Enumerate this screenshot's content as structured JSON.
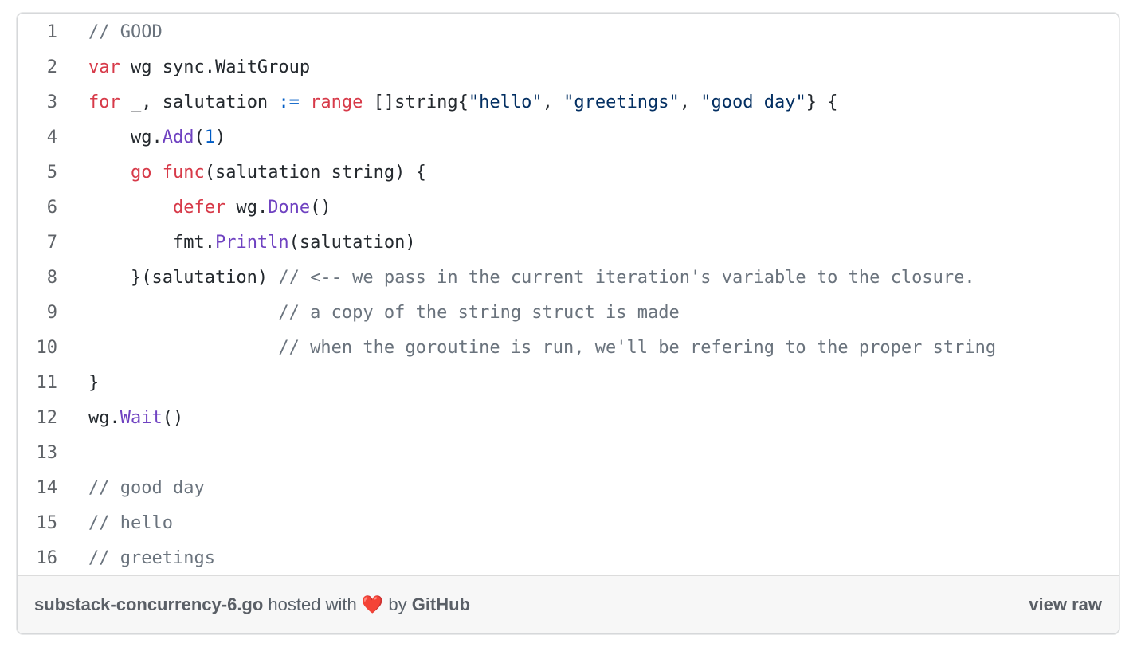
{
  "code": {
    "language": "go",
    "lines": [
      {
        "n": "1",
        "tokens": [
          {
            "t": "// GOOD",
            "c": "com"
          }
        ]
      },
      {
        "n": "2",
        "tokens": [
          {
            "t": "var",
            "c": "kw"
          },
          {
            "t": " wg sync.WaitGroup",
            "c": ""
          }
        ]
      },
      {
        "n": "3",
        "tokens": [
          {
            "t": "for",
            "c": "kw"
          },
          {
            "t": " _, salutation ",
            "c": ""
          },
          {
            "t": ":=",
            "c": "op"
          },
          {
            "t": " ",
            "c": ""
          },
          {
            "t": "range",
            "c": "kw"
          },
          {
            "t": " []string{",
            "c": ""
          },
          {
            "t": "\"hello\"",
            "c": "str"
          },
          {
            "t": ", ",
            "c": ""
          },
          {
            "t": "\"greetings\"",
            "c": "str"
          },
          {
            "t": ", ",
            "c": ""
          },
          {
            "t": "\"good day\"",
            "c": "str"
          },
          {
            "t": "} {",
            "c": ""
          }
        ]
      },
      {
        "n": "4",
        "tokens": [
          {
            "t": "    wg.",
            "c": ""
          },
          {
            "t": "Add",
            "c": "fn"
          },
          {
            "t": "(",
            "c": ""
          },
          {
            "t": "1",
            "c": "num"
          },
          {
            "t": ")",
            "c": ""
          }
        ]
      },
      {
        "n": "5",
        "tokens": [
          {
            "t": "    ",
            "c": ""
          },
          {
            "t": "go",
            "c": "kw"
          },
          {
            "t": " ",
            "c": ""
          },
          {
            "t": "func",
            "c": "kw"
          },
          {
            "t": "(salutation string) {",
            "c": ""
          }
        ]
      },
      {
        "n": "6",
        "tokens": [
          {
            "t": "        ",
            "c": ""
          },
          {
            "t": "defer",
            "c": "kw"
          },
          {
            "t": " wg.",
            "c": ""
          },
          {
            "t": "Done",
            "c": "fn"
          },
          {
            "t": "()",
            "c": ""
          }
        ]
      },
      {
        "n": "7",
        "tokens": [
          {
            "t": "        fmt.",
            "c": ""
          },
          {
            "t": "Println",
            "c": "fn"
          },
          {
            "t": "(salutation)",
            "c": ""
          }
        ]
      },
      {
        "n": "8",
        "tokens": [
          {
            "t": "    }(salutation) ",
            "c": ""
          },
          {
            "t": "// <-- we pass in the current iteration's variable to the closure.",
            "c": "com"
          }
        ]
      },
      {
        "n": "9",
        "tokens": [
          {
            "t": "                  ",
            "c": ""
          },
          {
            "t": "// a copy of the string struct is made",
            "c": "com"
          }
        ]
      },
      {
        "n": "10",
        "tokens": [
          {
            "t": "                  ",
            "c": ""
          },
          {
            "t": "// when the goroutine is run, we'll be refering to the proper string",
            "c": "com"
          }
        ]
      },
      {
        "n": "11",
        "tokens": [
          {
            "t": "}",
            "c": ""
          }
        ]
      },
      {
        "n": "12",
        "tokens": [
          {
            "t": "wg.",
            "c": ""
          },
          {
            "t": "Wait",
            "c": "fn"
          },
          {
            "t": "()",
            "c": ""
          }
        ]
      },
      {
        "n": "13",
        "tokens": []
      },
      {
        "n": "14",
        "tokens": [
          {
            "t": "// good day",
            "c": "com"
          }
        ]
      },
      {
        "n": "15",
        "tokens": [
          {
            "t": "// hello",
            "c": "com"
          }
        ]
      },
      {
        "n": "16",
        "tokens": [
          {
            "t": "// greetings",
            "c": "com"
          }
        ]
      }
    ]
  },
  "footer": {
    "filename": "substack-concurrency-6.go",
    "hosted_with": " hosted with ",
    "heart": "❤️",
    "by": " by ",
    "host": "GitHub",
    "view_raw": "view raw"
  }
}
